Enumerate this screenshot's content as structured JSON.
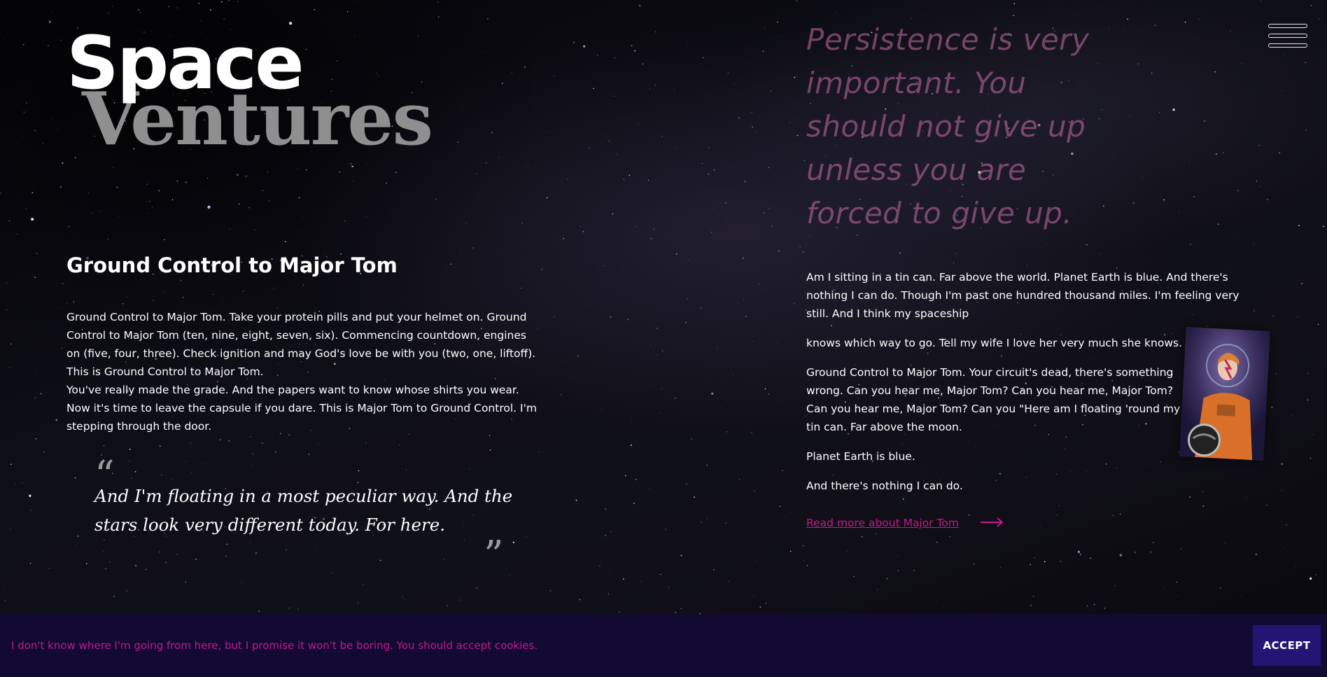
{
  "brand": {
    "line1": "Space",
    "line2": "Ventures"
  },
  "menu": {
    "icon": "hamburger-menu-icon"
  },
  "left": {
    "heading": "Ground Control to Major Tom",
    "intro_p1": "Ground Control to Major Tom. Take your protein pills and put your helmet on. Ground Control to Major Tom (ten, nine, eight, seven, six). Commencing countdown, engines on (five, four, three). Check ignition and may God's love be with you (two, one, liftoff). This is Ground Control to Major Tom.",
    "intro_p2": "You've really made the grade. And the papers want to know whose shirts you wear. Now it's time to leave the capsule if you dare. This is Major Tom to Ground Control. I'm stepping through the door.",
    "quote": {
      "open_mark": "“",
      "text": "And I'm floating in a most peculiar way. And the stars look very different today. For here.",
      "close_mark": "”"
    }
  },
  "right": {
    "pull_quote_lines": [
      "Persistence is very",
      "important. You",
      "should not give up",
      "unless you are",
      "forced to give up."
    ],
    "paragraphs": [
      "Am I sitting in a tin can. Far above the world. Planet Earth is blue. And there's nothing I can do. Though I'm past one hundred thousand miles. I'm feeling very still. And I think my spaceship",
      "knows which way to go. Tell my wife I love her very much she knows.",
      "Ground Control to Major Tom. Your circuit's dead, there's something wrong. Can you hear me, Major Tom? Can you hear me, Major Tom? Can you hear me, Major Tom? Can you \"Here am I floating 'round my tin can. Far above the moon.",
      "Planet Earth is blue.",
      "And there's nothing I can do."
    ],
    "read_more": "Read more about Major Tom",
    "read_more_icon": "arrow-right-icon"
  },
  "cookie": {
    "text": "I don't know where I'm going from here, but I promise it won't be boring. You should accept cookies.",
    "accept": "ACCEPT"
  },
  "colors": {
    "accent": "#c2188f",
    "cookie_bg": "#120a33",
    "button_bg": "#241474",
    "ventures": "#8f8f8f"
  }
}
